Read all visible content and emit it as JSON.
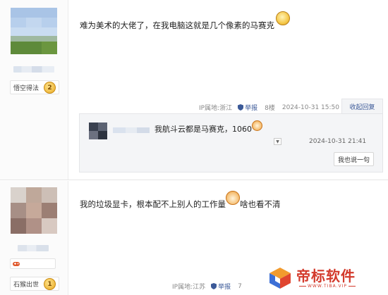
{
  "posts": [
    {
      "user_badge": "悟空得法",
      "badge_level": "2",
      "content": "难为美术的大佬了，在我电脑这就是几个像素的马赛克",
      "ip_location": "IP属地:浙江",
      "report_label": "举报",
      "floor": "8楼",
      "time": "2024-10-31 15:50",
      "collapse_label": "收起回复",
      "reply": {
        "text": "我航斗云都是马赛克，1060",
        "time": "2024-10-31 21:41",
        "reply_button": "我也说一句"
      }
    },
    {
      "user_badge": "石猴出世",
      "badge_level": "1",
      "content_before": "我的垃圾显卡，根本配不上别人的工作量",
      "content_after": "啥也看不清",
      "ip_location": "IP属地:江苏",
      "report_label": "举报",
      "floor": "7"
    }
  ],
  "watermark": {
    "title": "帝标软件",
    "subtitle": "WWW.TIBA.VIP"
  },
  "colors": {
    "link": "#3b5998",
    "watermark": "#d33a2c",
    "reply_bg": "#f4f5f7"
  }
}
